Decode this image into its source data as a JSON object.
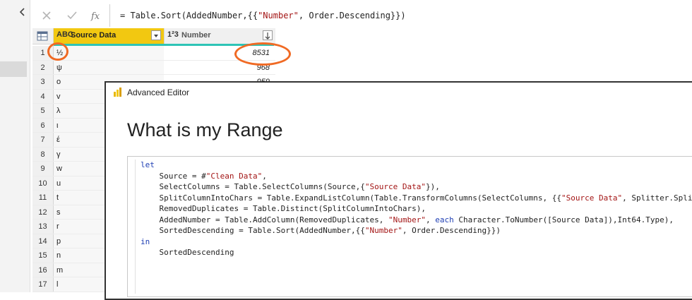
{
  "formula": {
    "prefix": "= Table.Sort(AddedNumber,{{",
    "str1": "\"Number\"",
    "suffix": ", Order.Descending}})"
  },
  "grid": {
    "column_type_1": "ABC",
    "column_name_1": "Source Data",
    "column_type_2": "1²3",
    "column_name_2": "Number",
    "rows": [
      {
        "n": "1",
        "source": "½",
        "number": "8531"
      },
      {
        "n": "2",
        "source": "ψ",
        "number": "968"
      },
      {
        "n": "3",
        "source": "o",
        "number": "959"
      },
      {
        "n": "4",
        "source": "v",
        "number": ""
      },
      {
        "n": "5",
        "source": "λ",
        "number": ""
      },
      {
        "n": "6",
        "source": "ι",
        "number": ""
      },
      {
        "n": "7",
        "source": "έ",
        "number": ""
      },
      {
        "n": "8",
        "source": "γ",
        "number": ""
      },
      {
        "n": "9",
        "source": "w",
        "number": ""
      },
      {
        "n": "10",
        "source": "u",
        "number": ""
      },
      {
        "n": "11",
        "source": "t",
        "number": ""
      },
      {
        "n": "12",
        "source": "s",
        "number": ""
      },
      {
        "n": "13",
        "source": "r",
        "number": ""
      },
      {
        "n": "14",
        "source": "p",
        "number": ""
      },
      {
        "n": "15",
        "source": "n",
        "number": ""
      },
      {
        "n": "16",
        "source": "m",
        "number": ""
      },
      {
        "n": "17",
        "source": "l",
        "number": ""
      }
    ]
  },
  "editor": {
    "window_title": "Advanced Editor",
    "heading": "What is my Range",
    "code": {
      "let": "let",
      "in": "in",
      "l1a": "    Source = #",
      "l1s": "\"Clean Data\"",
      "l1b": ",",
      "l2a": "    SelectColumns = Table.SelectColumns(Source,{",
      "l2s": "\"Source Data\"",
      "l2b": "}),",
      "l3a": "    SplitColumnIntoChars = Table.ExpandListColumn(Table.TransformColumns(SelectColumns, {{",
      "l3s": "\"Source Data\"",
      "l3b": ", Splitter.SplitTex",
      "l4": "    RemovedDuplicates = Table.Distinct(SplitColumnIntoChars),",
      "l5a": "    AddedNumber = Table.AddColumn(RemovedDuplicates, ",
      "l5s": "\"Number\"",
      "l5b": ", ",
      "l5k": "each",
      "l5c": " Character.ToNumber([Source Data]),Int64.Type),",
      "l6a": "    SortedDescending = Table.Sort(AddedNumber,{{",
      "l6s": "\"Number\"",
      "l6b": ", Order.Descending}})",
      "l7": "    SortedDescending"
    }
  },
  "colors": {
    "accent_yellow": "#f2c811",
    "annotation_orange": "#f06a24",
    "keyword_blue": "#1f3fb4",
    "string_red": "#a31515"
  }
}
